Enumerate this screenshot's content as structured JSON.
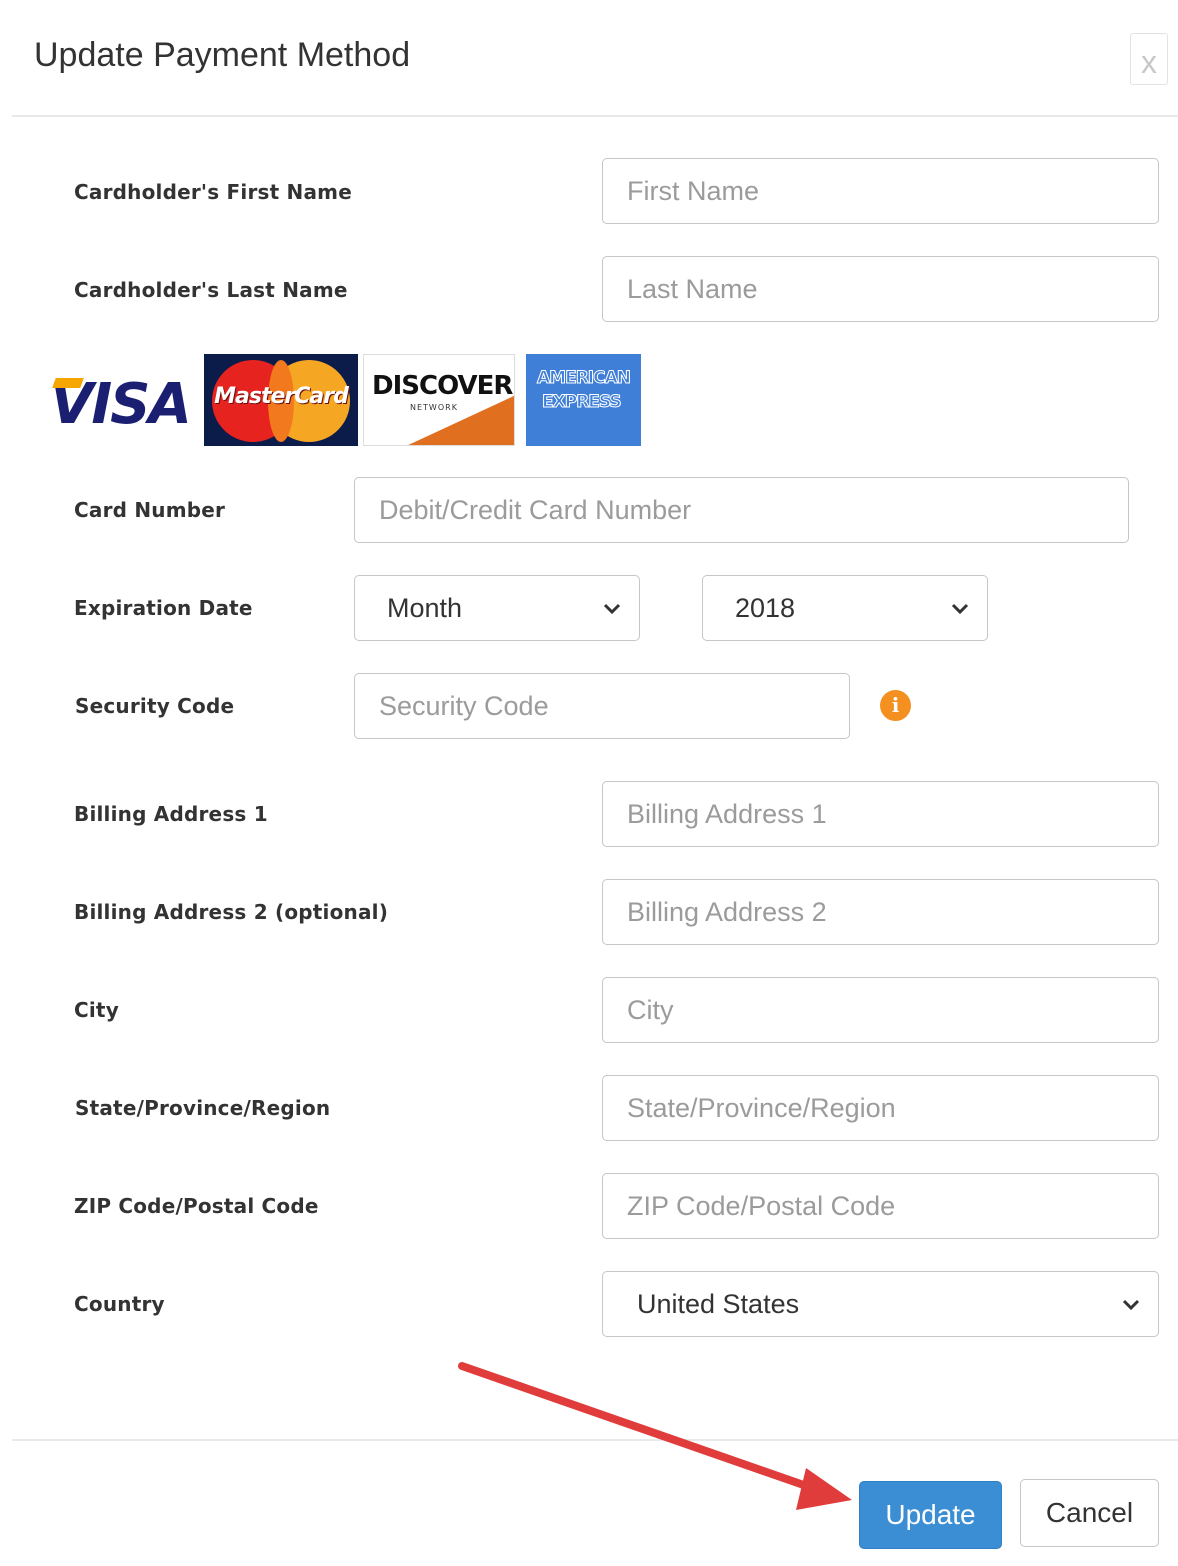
{
  "modal": {
    "title": "Update Payment Method",
    "close_label": "x"
  },
  "form": {
    "first_name": {
      "label": "Cardholder's First Name",
      "placeholder": "First Name"
    },
    "last_name": {
      "label": "Cardholder's Last Name",
      "placeholder": "Last Name"
    },
    "card_logos": {
      "visa": "VISA",
      "mastercard": "MasterCard",
      "discover": "DISCOVER",
      "discover_sub": "NETWORK",
      "amex_line1": "AMERICAN",
      "amex_line2": "EXPRESS"
    },
    "card_number": {
      "label": "Card Number",
      "placeholder": "Debit/Credit Card Number"
    },
    "expiration": {
      "label": "Expiration Date",
      "month_value": "Month",
      "year_value": "2018"
    },
    "security_code": {
      "label": "Security Code",
      "placeholder": "Security Code",
      "info_icon": "info-icon"
    },
    "billing1": {
      "label": "Billing Address 1",
      "placeholder": "Billing Address 1"
    },
    "billing2": {
      "label": "Billing Address 2 (optional)",
      "placeholder": "Billing Address 2"
    },
    "city": {
      "label": "City",
      "placeholder": "City"
    },
    "state": {
      "label": "State/Province/Region",
      "placeholder": "State/Province/Region"
    },
    "zip": {
      "label": "ZIP Code/Postal Code",
      "placeholder": "ZIP Code/Postal Code"
    },
    "country": {
      "label": "Country",
      "value": "United States"
    }
  },
  "footer": {
    "update_label": "Update",
    "cancel_label": "Cancel"
  },
  "colors": {
    "primary_button": "#3b8ed3",
    "info_icon": "#f39020",
    "annotation_arrow": "#e03c3c"
  }
}
